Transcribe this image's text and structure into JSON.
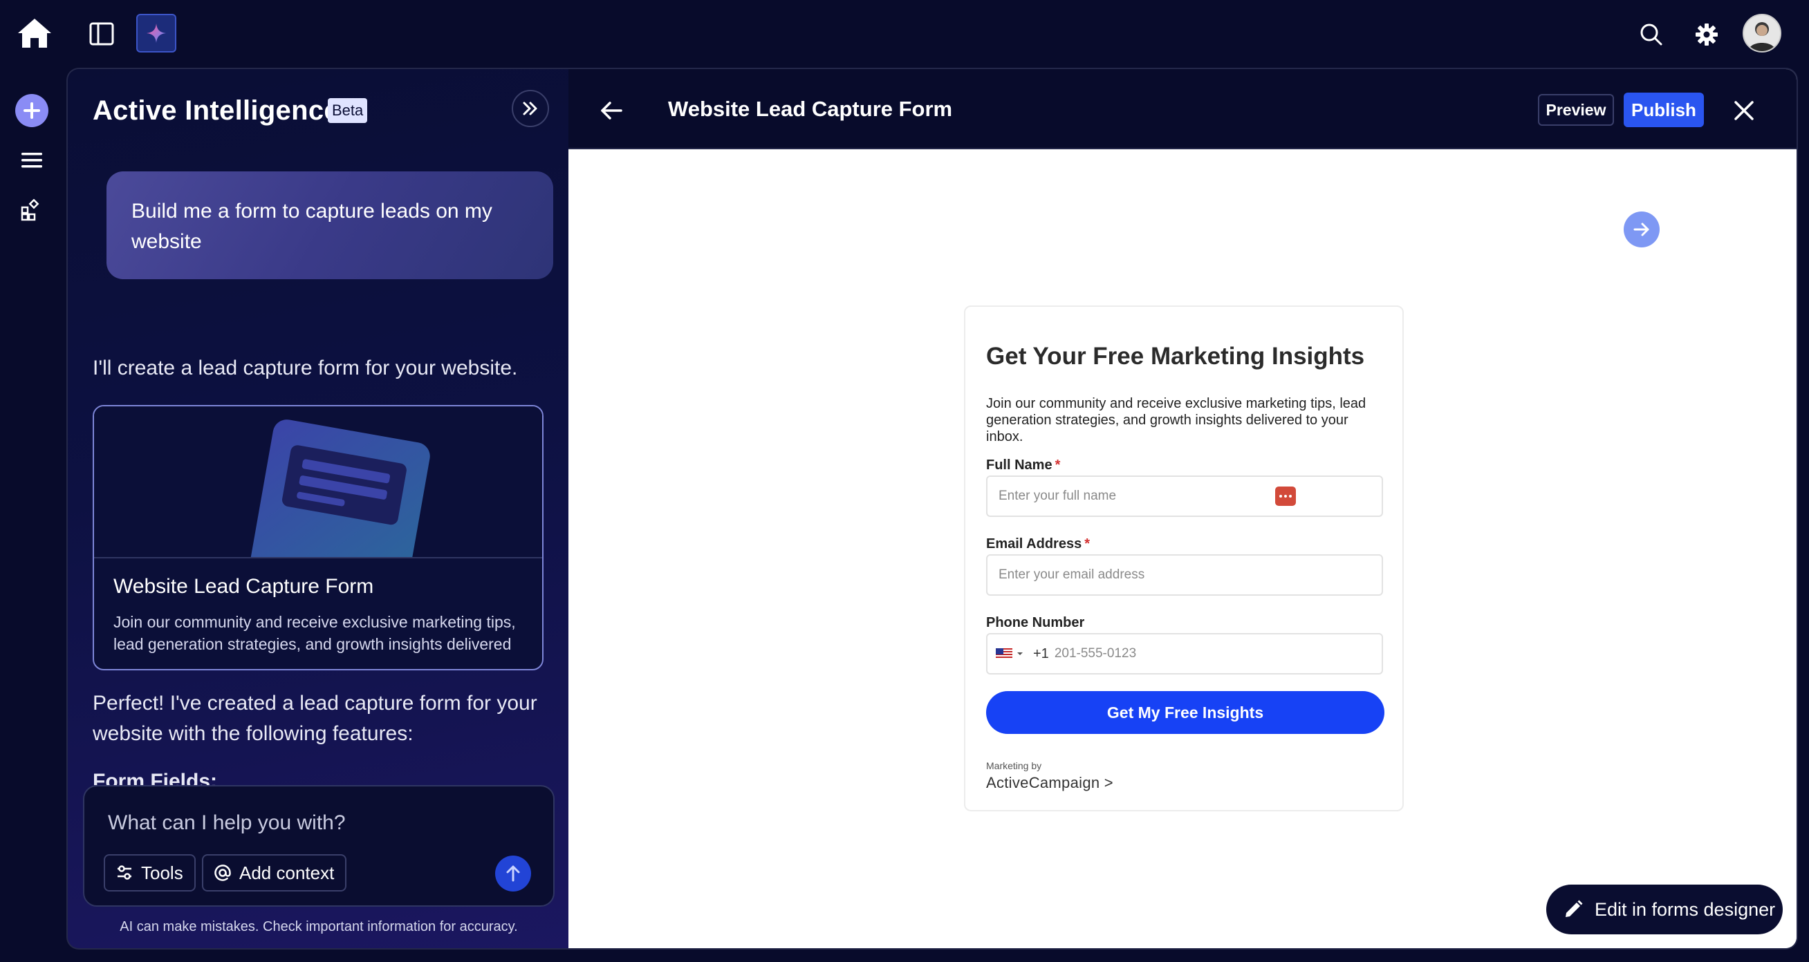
{
  "topbar": {
    "home_icon": "home-icon",
    "panel_icon": "sidebar-toggle-icon",
    "ai_icon": "sparkle-icon",
    "search_icon": "search-icon",
    "settings_icon": "gear-icon",
    "avatar": "user-avatar"
  },
  "rail": {
    "items": [
      "plus-icon",
      "menu-icon",
      "apps-icon"
    ]
  },
  "chat": {
    "title": "Active Intelligence",
    "badge": "Beta",
    "user_message": "Build me a form to capture leads on my website",
    "ai_intro": "I'll create a lead capture form for your website.",
    "card": {
      "title": "Website Lead Capture Form",
      "description": "Join our community and receive exclusive marketing tips, lead generation strategies, and growth insights delivered to..."
    },
    "ai_followup": "Perfect! I've created a lead capture form for your website with the following features:",
    "ai_heading": "Form Fields:",
    "composer": {
      "placeholder": "What can I help you with?",
      "tools_label": "Tools",
      "context_label": "Add context"
    },
    "disclaimer": "AI can make mistakes. Check important information for accuracy."
  },
  "pane": {
    "title": "Website Lead Capture Form",
    "preview_label": "Preview",
    "publish_label": "Publish",
    "edit_label": "Edit in forms designer"
  },
  "form": {
    "heading": "Get Your Free Marketing Insights",
    "intro": "Join our community and receive exclusive marketing tips, lead generation strategies, and growth insights delivered to your inbox.",
    "fields": {
      "name_label": "Full Name",
      "name_placeholder": "Enter your full name",
      "email_label": "Email Address",
      "email_placeholder": "Enter your email address",
      "phone_label": "Phone Number",
      "phone_code": "+1",
      "phone_placeholder": "201-555-0123",
      "required_mark": "*"
    },
    "submit_label": "Get My Free Insights",
    "footer_small": "Marketing by",
    "footer_brand": "ActiveCampaign >"
  },
  "colors": {
    "background": "#080b2b",
    "accent_blue": "#2a55f0",
    "submit_blue": "#1742f5",
    "required_red": "#d32f2f"
  }
}
